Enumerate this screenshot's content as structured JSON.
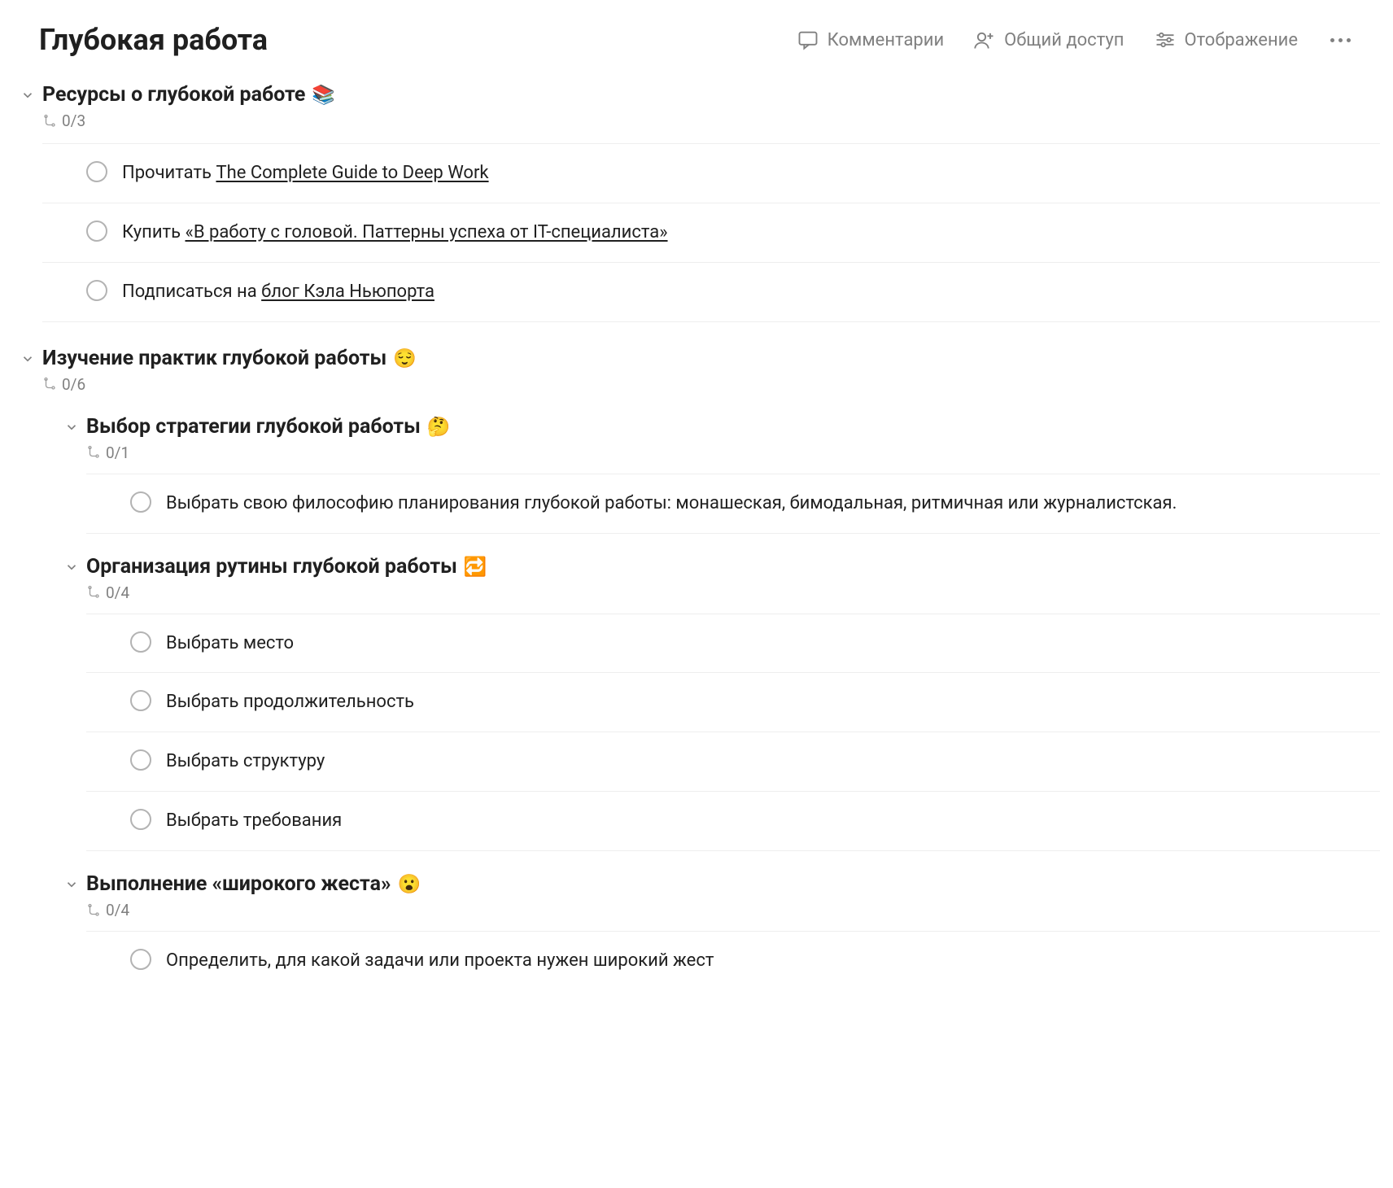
{
  "header": {
    "title": "Глубокая работа",
    "comments": "Комментарии",
    "share": "Общий доступ",
    "view": "Отображение"
  },
  "sections": [
    {
      "title": "Ресурсы о глубокой работе",
      "emoji": "📚",
      "count": "0/3",
      "tasks": [
        {
          "prefix": "Прочитать ",
          "link": "The Complete Guide to Deep Work"
        },
        {
          "prefix": "Купить ",
          "link": "«В работу с головой. Паттерны успеха от IT-специалиста»"
        },
        {
          "prefix": "Подписаться на ",
          "link": "блог Кэла Ньюпорта"
        }
      ]
    },
    {
      "title": "Изучение практик глубокой работы",
      "emoji": "😌",
      "count": "0/6",
      "children": [
        {
          "title": "Выбор стратегии глубокой работы",
          "emoji": "🤔",
          "count": "0/1",
          "tasks": [
            {
              "text": "Выбрать свою философию планирования глубокой работы: монашеская, бимодальная, ритмичная или журналистская."
            }
          ]
        },
        {
          "title": "Организация рутины глубокой работы",
          "emoji": "🔁",
          "count": "0/4",
          "tasks": [
            {
              "text": "Выбрать место"
            },
            {
              "text": "Выбрать продолжительность"
            },
            {
              "text": "Выбрать структуру"
            },
            {
              "text": "Выбрать требования"
            }
          ]
        },
        {
          "title": "Выполнение «широкого жеста»",
          "emoji": "😮",
          "count": "0/4",
          "tasks": [
            {
              "text": "Определить, для какой задачи или проекта нужен широкий жест"
            }
          ]
        }
      ]
    }
  ]
}
